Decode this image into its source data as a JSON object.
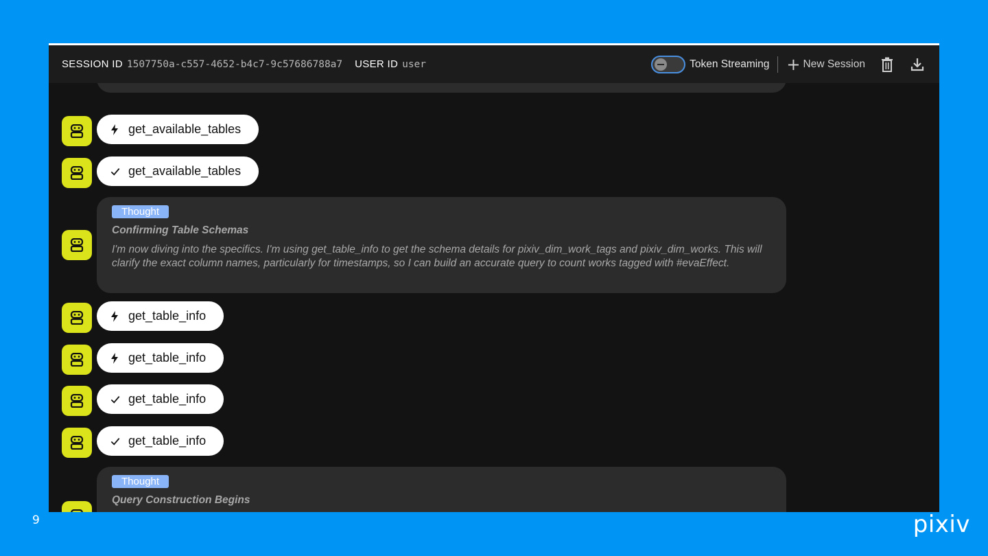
{
  "slide": {
    "number": "9",
    "logo": "pixiv"
  },
  "header": {
    "session_label": "SESSION ID",
    "session_id": "1507750a-c557-4652-b4c7-9c57686788a7",
    "user_label": "USER ID",
    "user_id": "user",
    "streaming_label": "Token Streaming",
    "streaming_on": false,
    "new_session_label": "New Session",
    "accent": "#4a90e2"
  },
  "messages": {
    "m1": {
      "kind": "tool-call",
      "icon": "bolt-icon",
      "name": "get_available_tables"
    },
    "m2": {
      "kind": "tool-result",
      "icon": "check-icon",
      "name": "get_available_tables"
    },
    "m3": {
      "kind": "thought",
      "badge": "Thought",
      "title": "Confirming Table Schemas",
      "body": "I'm now diving into the specifics. I'm using get_table_info to get the schema details for pixiv_dim_work_tags and pixiv_dim_works. This will clarify the exact column names, particularly for timestamps, so I can build an accurate query to count works tagged with #evaEffect."
    },
    "m4": {
      "kind": "tool-call",
      "icon": "bolt-icon",
      "name": "get_table_info"
    },
    "m5": {
      "kind": "tool-call",
      "icon": "bolt-icon",
      "name": "get_table_info"
    },
    "m6": {
      "kind": "tool-result",
      "icon": "check-icon",
      "name": "get_table_info"
    },
    "m7": {
      "kind": "tool-result",
      "icon": "check-icon",
      "name": "get_table_info"
    },
    "m8": {
      "kind": "thought",
      "badge": "Thought",
      "title": "Query Construction Begins"
    }
  },
  "colors": {
    "slide_bg": "#0095F5",
    "avatar": "#dbe31a",
    "badge": "#8ab4f8"
  }
}
